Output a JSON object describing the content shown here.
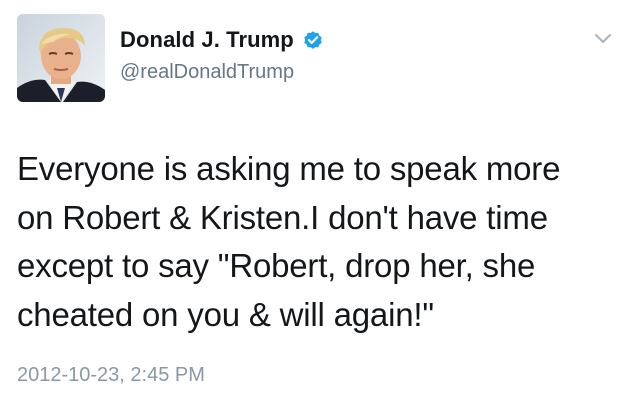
{
  "tweet": {
    "display_name": "Donald J. Trump",
    "handle": "@realDonaldTrump",
    "text": "Everyone is asking me to speak more\non Robert & Kristen.I don't have time\nexcept to say \"Robert, drop her, she\ncheated on you & will again!\"",
    "timestamp": "2012-10-23, 2:45 PM"
  },
  "icons": {
    "verified": "verified-badge-icon",
    "menu": "chevron-down-icon"
  },
  "colors": {
    "verified": "#1da1f2",
    "handle": "#657786",
    "timestamp": "#8899a6",
    "text": "#14171a"
  }
}
